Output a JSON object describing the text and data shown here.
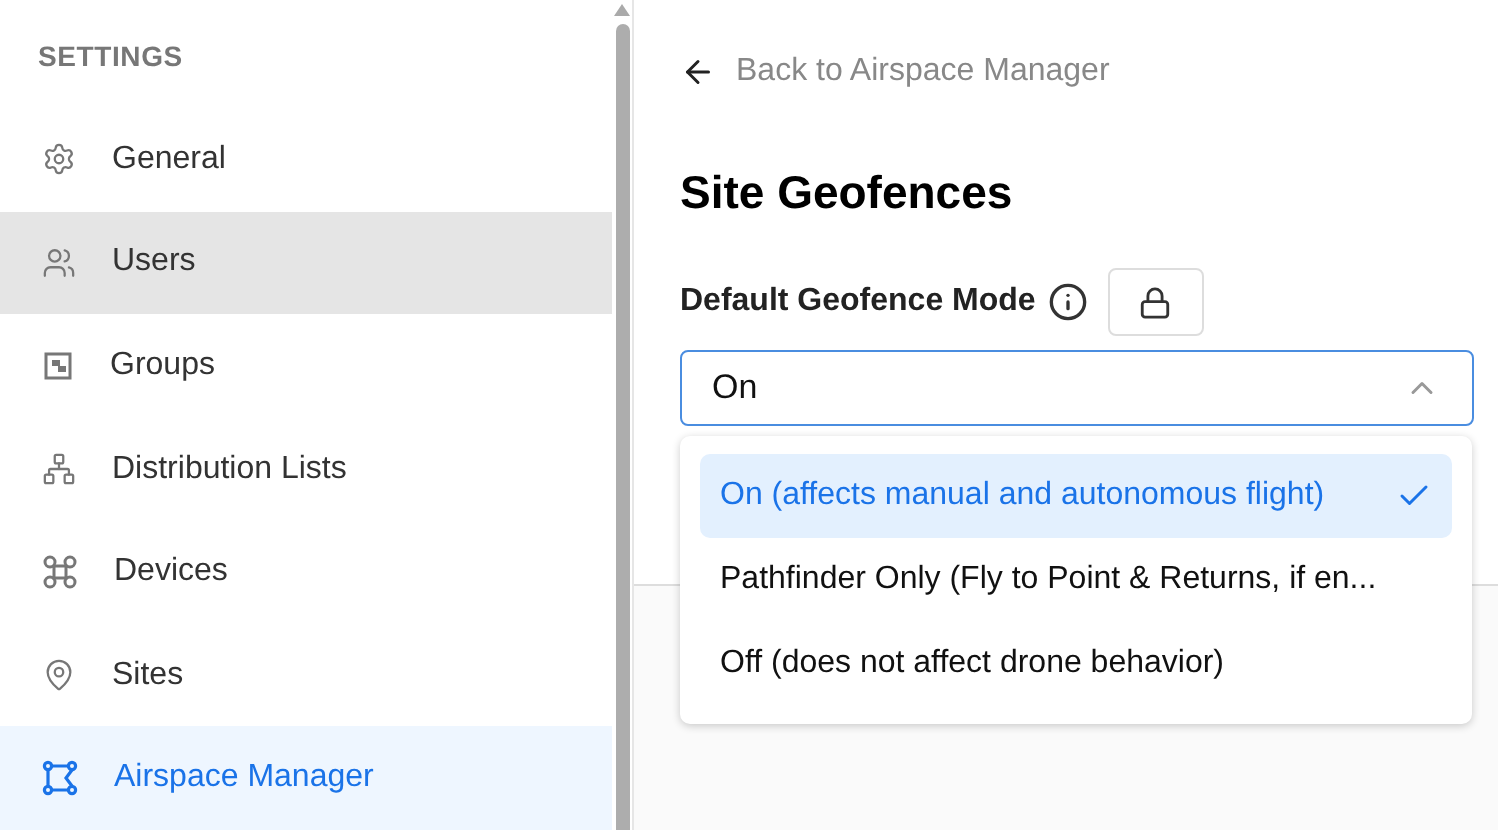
{
  "sidebar": {
    "heading": "SETTINGS",
    "items": [
      {
        "label": "General",
        "kind": "gear",
        "hovered": false,
        "selected": false
      },
      {
        "label": "Users",
        "kind": "users",
        "hovered": true,
        "selected": false
      },
      {
        "label": "Groups",
        "kind": "groups",
        "hovered": false,
        "selected": false
      },
      {
        "label": "Distribution Lists",
        "kind": "tree",
        "hovered": false,
        "selected": false
      },
      {
        "label": "Devices",
        "kind": "drone",
        "hovered": false,
        "selected": false
      },
      {
        "label": "Sites",
        "kind": "pin",
        "hovered": false,
        "selected": false
      },
      {
        "label": "Airspace Manager",
        "kind": "airspace",
        "hovered": false,
        "selected": true
      }
    ]
  },
  "back_link": "Back to Airspace Manager",
  "title": "Site Geofences",
  "field": {
    "label": "Default Geofence Mode",
    "value": "On",
    "expanded": true,
    "options": [
      {
        "label": "On (affects manual and autonomous flight)",
        "selected": true
      },
      {
        "label": "Pathfinder Only (Fly to Point & Returns, if en...",
        "selected": false
      },
      {
        "label": "Off (does not affect drone behavior)",
        "selected": false
      }
    ]
  }
}
